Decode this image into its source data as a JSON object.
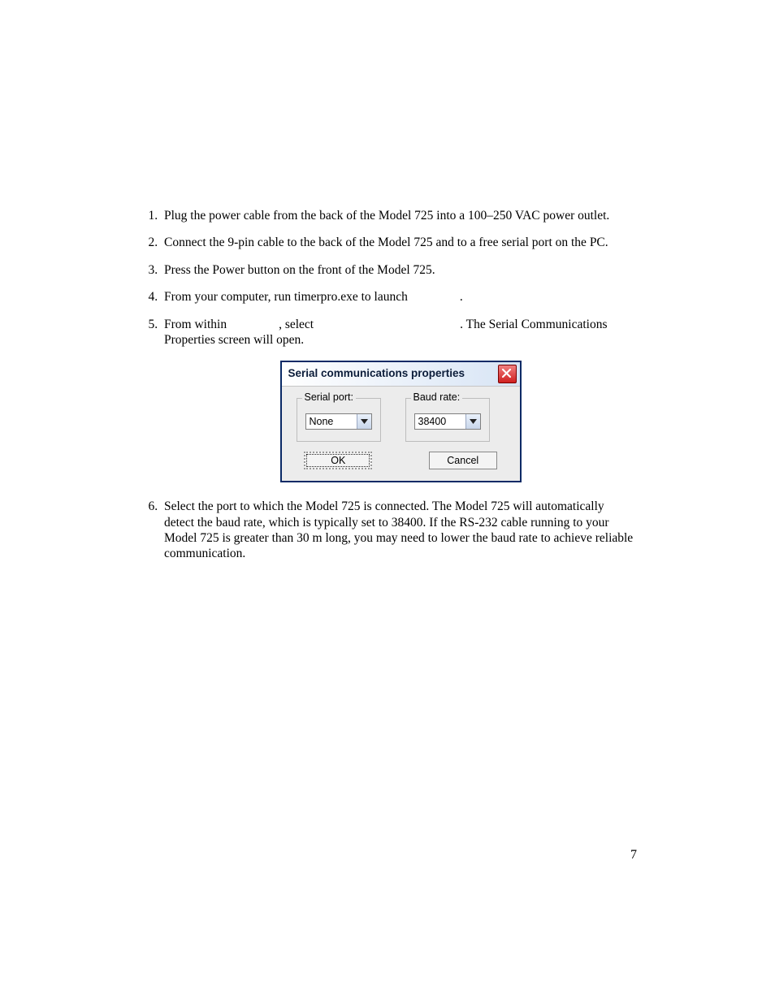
{
  "steps": {
    "s1": "Plug the power cable from the back of the Model 725 into a 100–250 VAC power outlet.",
    "s2": "Connect the 9-pin cable to the back of the Model 725 and to a free serial port on the PC.",
    "s3": "Press the Power button on the front of the Model 725.",
    "s4_a": "From your computer, run timerpro.exe to launch",
    "s4_b": ".",
    "s5_a": "From within",
    "s5_b": ", select",
    "s5_c": ". The Serial Communications Properties screen will open.",
    "s6": "Select the port to which the Model 725 is connected. The Model 725 will automatically detect the baud rate, which is typically set to 38400. If the RS-232 cable running to your Model 725 is greater than 30 m long, you may need to lower the baud rate to achieve reliable communication."
  },
  "dialog": {
    "title": "Serial communications properties",
    "serial_port_label": "Serial port:",
    "serial_port_value": "None",
    "baud_rate_label": "Baud rate:",
    "baud_rate_value": "38400",
    "ok": "OK",
    "cancel": "Cancel"
  },
  "page_number": "7"
}
